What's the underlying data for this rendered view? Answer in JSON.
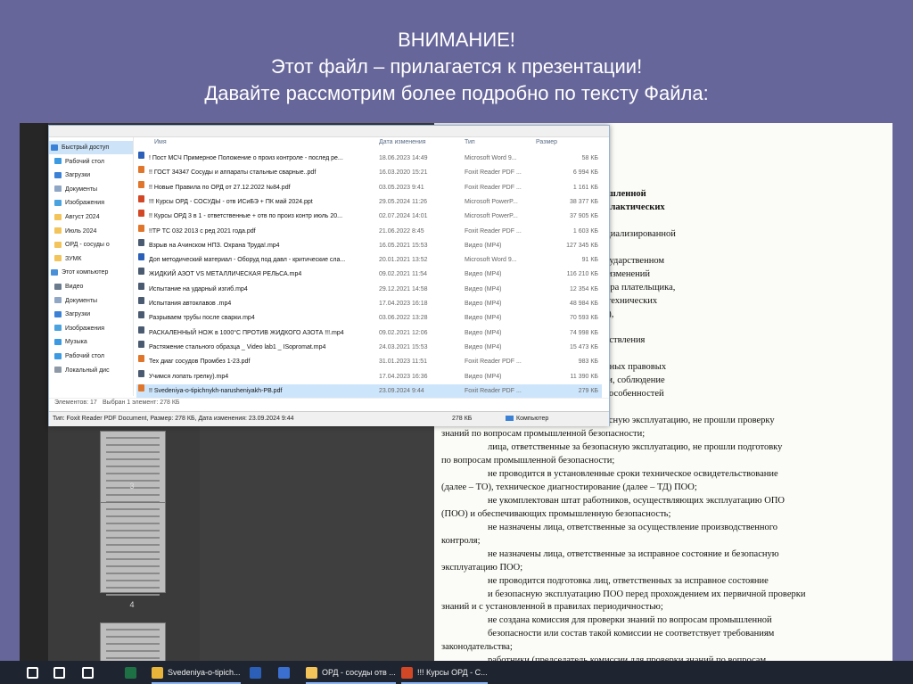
{
  "slide": {
    "line1": "ВНИМАНИЕ!",
    "line2": "Этот файл – прилагается к презентации!",
    "line3": "Давайте рассмотрим более подробно по тексту Файла:"
  },
  "thumbnails": {
    "page3": "3",
    "page4": "4"
  },
  "explorer": {
    "columns": {
      "name": "Имя",
      "date": "Дата изменения",
      "type": "Тип",
      "size": "Размер"
    },
    "nav": [
      {
        "label": "Быстрый доступ",
        "icon": "star-icon",
        "color": "#3b82d6"
      },
      {
        "label": "Рабочий стол",
        "icon": "desktop-icon",
        "color": "#3b9ae1"
      },
      {
        "label": "Загрузки",
        "icon": "download-icon",
        "color": "#3b82d6"
      },
      {
        "label": "Документы",
        "icon": "document-icon",
        "color": "#8fa7c4"
      },
      {
        "label": "Изображения",
        "icon": "image-icon",
        "color": "#4aa3df"
      },
      {
        "label": "Август 2024",
        "icon": "folder-icon",
        "color": "#f2c45a"
      },
      {
        "label": "Июль 2024",
        "icon": "folder-icon",
        "color": "#f2c45a"
      },
      {
        "label": "ОРД - сосуды о",
        "icon": "folder-icon",
        "color": "#f2c45a"
      },
      {
        "label": "ЗУМК",
        "icon": "folder-icon",
        "color": "#f2c45a"
      },
      {
        "label": "Этот компьютер",
        "icon": "computer-icon",
        "color": "#4a90d9"
      },
      {
        "label": "Видео",
        "icon": "video-icon",
        "color": "#6b7b8e"
      },
      {
        "label": "Документы",
        "icon": "document-icon",
        "color": "#8fa7c4"
      },
      {
        "label": "Загрузки",
        "icon": "download-icon",
        "color": "#3b82d6"
      },
      {
        "label": "Изображения",
        "icon": "image-icon",
        "color": "#4aa3df"
      },
      {
        "label": "Музыка",
        "icon": "music-icon",
        "color": "#3b9ae1"
      },
      {
        "label": "Рабочий стол",
        "icon": "desktop-icon",
        "color": "#3b9ae1"
      },
      {
        "label": "Локальный дис",
        "icon": "drive-icon",
        "color": "#8d99a6"
      }
    ],
    "files": [
      {
        "name": "! Пост МСЧ Примерное Положение о произ контроле - послед ре...",
        "date": "18.06.2023 14:49",
        "type": "Microsoft Word 9...",
        "size": "58 КБ",
        "icon": "word-icon",
        "color": "#2b5fb8"
      },
      {
        "name": "!! ГОСТ 34347 Сосуды и аппараты стальные сварные..pdf",
        "date": "16.03.2020 15:21",
        "type": "Foxit Reader PDF ...",
        "size": "6 994 КБ",
        "icon": "pdf-icon",
        "color": "#e0762b"
      },
      {
        "name": "!! Новые Правила по ОРД от 27.12.2022 №84.pdf",
        "date": "03.05.2023 9:41",
        "type": "Foxit Reader PDF ...",
        "size": "1 161 КБ",
        "icon": "pdf-icon",
        "color": "#e0762b"
      },
      {
        "name": "!!! Курсы ОРД - СОСУДЫ - отв ИСиБЭ + ПК май 2024.ppt",
        "date": "29.05.2024 11:26",
        "type": "Microsoft PowerP...",
        "size": "38 377 КБ",
        "icon": "powerpoint-icon",
        "color": "#d24726"
      },
      {
        "name": "!! Курсы ОРД 3 в 1 - ответственные + отв по произ контр июль 20...",
        "date": "02.07.2024 14:01",
        "type": "Microsoft PowerP...",
        "size": "37 905 КБ",
        "icon": "powerpoint-icon",
        "color": "#d24726"
      },
      {
        "name": "!!ТР ТС 032 2013 с ред 2021 года.pdf",
        "date": "21.06.2022 8:45",
        "type": "Foxit Reader PDF ...",
        "size": "1 603 КБ",
        "icon": "pdf-icon",
        "color": "#e0762b"
      },
      {
        "name": "Взрыв на Ачинском НПЗ. Охрана Труда!.mp4",
        "date": "16.05.2021 15:53",
        "type": "Видео (MP4)",
        "size": "127 345 КБ",
        "icon": "video-file-icon",
        "color": "#4a5a70"
      },
      {
        "name": "Доп методический материал - Оборуд под давл - критические сла...",
        "date": "20.01.2021 13:52",
        "type": "Microsoft Word 9...",
        "size": "91 КБ",
        "icon": "word-icon",
        "color": "#2b5fb8"
      },
      {
        "name": "ЖИДКИЙ АЗОТ VS МЕТАЛЛИЧЕСКАЯ РЕЛЬСА.mp4",
        "date": "09.02.2021 11:54",
        "type": "Видео (MP4)",
        "size": "116 210 КБ",
        "icon": "video-file-icon",
        "color": "#4a5a70"
      },
      {
        "name": "Испытание на ударный изгиб.mp4",
        "date": "29.12.2021 14:58",
        "type": "Видео (MP4)",
        "size": "12 354 КБ",
        "icon": "video-file-icon",
        "color": "#4a5a70"
      },
      {
        "name": "Испытания автоклавов .mp4",
        "date": "17.04.2023 16:18",
        "type": "Видео (MP4)",
        "size": "48 984 КБ",
        "icon": "video-file-icon",
        "color": "#4a5a70"
      },
      {
        "name": "Разрываем трубы после сварки.mp4",
        "date": "03.06.2022 13:28",
        "type": "Видео (MP4)",
        "size": "70 593 КБ",
        "icon": "video-file-icon",
        "color": "#4a5a70"
      },
      {
        "name": "РАСКАЛЕННЫЙ НОЖ в 1000°С ПРОТИВ ЖИДКОГО АЗОТА !!!.mp4",
        "date": "09.02.2021 12:06",
        "type": "Видео (MP4)",
        "size": "74 998 КБ",
        "icon": "video-file-icon",
        "color": "#4a5a70"
      },
      {
        "name": "Растяжение стального образца _ Video lab1 _ ISopromat.mp4",
        "date": "24.03.2021 15:53",
        "type": "Видео (MP4)",
        "size": "15 473 КБ",
        "icon": "video-file-icon",
        "color": "#4a5a70"
      },
      {
        "name": "Тех диаг сосудов Промбез 1-23.pdf",
        "date": "31.01.2023 11:51",
        "type": "Foxit Reader PDF ...",
        "size": "983 КБ",
        "icon": "pdf-icon",
        "color": "#e0762b"
      },
      {
        "name": "Учимся лопать грелку).mp4",
        "date": "17.04.2023 16:36",
        "type": "Видео (MP4)",
        "size": "11 390 КБ",
        "icon": "video-file-icon",
        "color": "#4a5a70"
      },
      {
        "name": "!! Svedeniya-o-tipichnykh-narusheniyakh-PB.pdf",
        "date": "23.09.2024 9:44",
        "type": "Foxit Reader PDF ...",
        "size": "279 КБ",
        "icon": "pdf-icon",
        "color": "#e0762b"
      }
    ],
    "status": {
      "count": "Элементов: 17",
      "selected": "Выбран 1 элемент: 278 КБ"
    },
    "details": {
      "text": "Тип: Foxit Reader PDF Document, Размер: 278 КБ, Дата изменения: 23.09.2024 9:44",
      "size": "278 КБ",
      "location": "Компьютер"
    }
  },
  "document": {
    "lines": [
      {
        "text": "шениях в области обеспечения промышленной",
        "bold": true
      },
      {
        "text": "емых при проведении надзорно-профилактических",
        "bold": true
      },
      {
        "text": "",
        "bold": false
      },
      {
        "text": "ензия (либо не заключен договор со специализированной",
        "bold": false
      },
      {
        "text": "",
        "bold": false
      },
      {
        "text": "менения в сведения, содержащиеся в государственном",
        "bold": false
      },
      {
        "text": "оизводственных объектов, при наличии изменений",
        "bold": false
      },
      {
        "text": "ического адреса субъекта, учетного номера плательщика,",
        "bold": false
      },
      {
        "text": "изводственного объекта (далее – ОПО), технических",
        "bold": false
      },
      {
        "text": "циально опасного объекта (далее – ПОО),",
        "bold": false
      },
      {
        "text": "омеров и т.д;",
        "bold": false
      },
      {
        "text": "ложение о порядке организации и осуществления",
        "bold": false
      },
      {
        "text": "нтроля;",
        "bold": false
      },
      {
        "text": "роверка знаний рабочих в объеме локальных правовых",
        "bold": false
      },
      {
        "text": "требования промышленной безопасности, соблюдение",
        "bold": false
      },
      {
        "text": "функциональных обязанности, с учетом особенностей",
        "bold": false
      },
      {
        "text": "ессов;",
        "bold": false
      },
      {
        "text": "лица, ответственные за безопасную эксплуатацию, не прошли проверку",
        "bold": false
      },
      {
        "text": "знаний по вопросам промышленной безопасности;",
        "bold": false
      },
      {
        "text": "лица, ответственные за безопасную эксплуатацию, не прошли подготовку",
        "bold": false
      },
      {
        "text": "по вопросам промышленной безопасности;",
        "bold": false
      },
      {
        "text": "не проводится в установленные сроки техническое освидетельствование",
        "bold": false
      },
      {
        "text": "(далее – ТО), техническое диагностирование (далее – ТД) ПОО;",
        "bold": false
      },
      {
        "text": "не укомплектован штат работников, осуществляющих эксплуатацию ОПО",
        "bold": false
      },
      {
        "text": "(ПОО) и обеспечивающих промышленную безопасность;",
        "bold": false
      },
      {
        "text": "не назначены лица, ответственные за осуществление производственного",
        "bold": false
      },
      {
        "text": "контроля;",
        "bold": false
      },
      {
        "text": "не назначены лица, ответственные за исправное состояние и безопасную",
        "bold": false
      },
      {
        "text": "эксплуатацию ПОО;",
        "bold": false
      },
      {
        "text": "не проводится подготовка лиц, ответственных за исправное состояние",
        "bold": false
      },
      {
        "text": "и безопасную эксплуатацию ПОО перед прохождением их первичной проверки",
        "bold": false
      },
      {
        "text": "знаний и с установленной в правилах периодичностью;",
        "bold": false
      },
      {
        "text": "не создана комиссия для проверки знаний по вопросам промышленной",
        "bold": false
      },
      {
        "text": "безопасности или состав такой комиссии не соответствует требованиям",
        "bold": false
      },
      {
        "text": "законодательства;",
        "bold": false
      },
      {
        "text": "работники (председатель комиссии для проверки знаний по вопросам",
        "bold": false
      }
    ]
  },
  "taskbar": {
    "items": [
      {
        "label": "",
        "icon": "windows-start-icon",
        "color": "#ffffff"
      },
      {
        "label": "",
        "icon": "search-icon",
        "color": "#ffffff"
      },
      {
        "label": "",
        "icon": "task-view-icon",
        "color": "#ffffff"
      },
      {
        "label": "",
        "icon": "excel-icon",
        "color": "#1e7145"
      },
      {
        "label": "Svedeniya-o-tipich...",
        "icon": "chrome-icon",
        "color": "#e8b53a"
      },
      {
        "label": "",
        "icon": "word-icon",
        "color": "#2b5fb8"
      },
      {
        "label": "",
        "icon": "save-disk-icon",
        "color": "#3b6fd0"
      },
      {
        "label": "ОРД - сосуды отв ...",
        "icon": "folder-icon",
        "color": "#f2c45a"
      },
      {
        "label": "!!! Курсы ОРД - С...",
        "icon": "powerpoint-icon",
        "color": "#d24726"
      }
    ]
  }
}
